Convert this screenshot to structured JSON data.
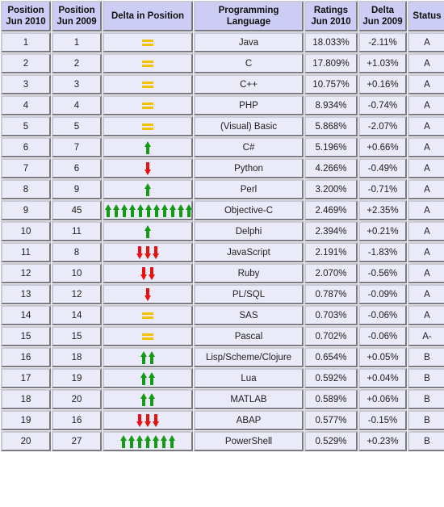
{
  "table": {
    "columns": [
      {
        "key": "position_new",
        "label": "Position\nJun 2010",
        "line1": "Position",
        "line2": "Jun 2010"
      },
      {
        "key": "position_old",
        "label": "Position\nJun 2009",
        "line1": "Position",
        "line2": "Jun 2009"
      },
      {
        "key": "delta_position",
        "label": "Delta in Position",
        "line1": "Delta in Position",
        "line2": ""
      },
      {
        "key": "language",
        "label": "Programming Language",
        "line1": "Programming Language",
        "line2": ""
      },
      {
        "key": "ratings",
        "label": "Ratings\nJun 2010",
        "line1": "Ratings",
        "line2": "Jun 2010"
      },
      {
        "key": "delta_ratings",
        "label": "Delta\nJun 2009",
        "line1": "Delta",
        "line2": "Jun 2009"
      },
      {
        "key": "status",
        "label": "Status",
        "line1": "Status",
        "line2": ""
      }
    ],
    "rows": [
      {
        "position_new": "1",
        "position_old": "1",
        "delta_icon": "equals-icon",
        "delta_count": 1,
        "language": "Java",
        "ratings": "18.033%",
        "delta_ratings": "-2.11%",
        "status": "A"
      },
      {
        "position_new": "2",
        "position_old": "2",
        "delta_icon": "equals-icon",
        "delta_count": 1,
        "language": "C",
        "ratings": "17.809%",
        "delta_ratings": "+1.03%",
        "status": "A"
      },
      {
        "position_new": "3",
        "position_old": "3",
        "delta_icon": "equals-icon",
        "delta_count": 1,
        "language": "C++",
        "ratings": "10.757%",
        "delta_ratings": "+0.16%",
        "status": "A"
      },
      {
        "position_new": "4",
        "position_old": "4",
        "delta_icon": "equals-icon",
        "delta_count": 1,
        "language": "PHP",
        "ratings": "8.934%",
        "delta_ratings": "-0.74%",
        "status": "A"
      },
      {
        "position_new": "5",
        "position_old": "5",
        "delta_icon": "equals-icon",
        "delta_count": 1,
        "language": "(Visual) Basic",
        "ratings": "5.868%",
        "delta_ratings": "-2.07%",
        "status": "A"
      },
      {
        "position_new": "6",
        "position_old": "7",
        "delta_icon": "arrow-up-icon",
        "delta_count": 1,
        "language": "C#",
        "ratings": "5.196%",
        "delta_ratings": "+0.66%",
        "status": "A"
      },
      {
        "position_new": "7",
        "position_old": "6",
        "delta_icon": "arrow-down-icon",
        "delta_count": 1,
        "language": "Python",
        "ratings": "4.266%",
        "delta_ratings": "-0.49%",
        "status": "A"
      },
      {
        "position_new": "8",
        "position_old": "9",
        "delta_icon": "arrow-up-icon",
        "delta_count": 1,
        "language": "Perl",
        "ratings": "3.200%",
        "delta_ratings": "-0.71%",
        "status": "A"
      },
      {
        "position_new": "9",
        "position_old": "45",
        "delta_icon": "arrow-up-icon",
        "delta_count": 11,
        "language": "Objective-C",
        "ratings": "2.469%",
        "delta_ratings": "+2.35%",
        "status": "A"
      },
      {
        "position_new": "10",
        "position_old": "11",
        "delta_icon": "arrow-up-icon",
        "delta_count": 1,
        "language": "Delphi",
        "ratings": "2.394%",
        "delta_ratings": "+0.21%",
        "status": "A"
      },
      {
        "position_new": "11",
        "position_old": "8",
        "delta_icon": "arrow-down-icon",
        "delta_count": 3,
        "language": "JavaScript",
        "ratings": "2.191%",
        "delta_ratings": "-1.83%",
        "status": "A"
      },
      {
        "position_new": "12",
        "position_old": "10",
        "delta_icon": "arrow-down-icon",
        "delta_count": 2,
        "language": "Ruby",
        "ratings": "2.070%",
        "delta_ratings": "-0.56%",
        "status": "A"
      },
      {
        "position_new": "13",
        "position_old": "12",
        "delta_icon": "arrow-down-icon",
        "delta_count": 1,
        "language": "PL/SQL",
        "ratings": "0.787%",
        "delta_ratings": "-0.09%",
        "status": "A"
      },
      {
        "position_new": "14",
        "position_old": "14",
        "delta_icon": "equals-icon",
        "delta_count": 1,
        "language": "SAS",
        "ratings": "0.703%",
        "delta_ratings": "-0.06%",
        "status": "A"
      },
      {
        "position_new": "15",
        "position_old": "15",
        "delta_icon": "equals-icon",
        "delta_count": 1,
        "language": "Pascal",
        "ratings": "0.702%",
        "delta_ratings": "-0.06%",
        "status": "A-"
      },
      {
        "position_new": "16",
        "position_old": "18",
        "delta_icon": "arrow-up-icon",
        "delta_count": 2,
        "language": "Lisp/Scheme/Clojure",
        "ratings": "0.654%",
        "delta_ratings": "+0.05%",
        "status": "B"
      },
      {
        "position_new": "17",
        "position_old": "19",
        "delta_icon": "arrow-up-icon",
        "delta_count": 2,
        "language": "Lua",
        "ratings": "0.592%",
        "delta_ratings": "+0.04%",
        "status": "B"
      },
      {
        "position_new": "18",
        "position_old": "20",
        "delta_icon": "arrow-up-icon",
        "delta_count": 2,
        "language": "MATLAB",
        "ratings": "0.589%",
        "delta_ratings": "+0.06%",
        "status": "B"
      },
      {
        "position_new": "19",
        "position_old": "16",
        "delta_icon": "arrow-down-icon",
        "delta_count": 3,
        "language": "ABAP",
        "ratings": "0.577%",
        "delta_ratings": "-0.15%",
        "status": "B"
      },
      {
        "position_new": "20",
        "position_old": "27",
        "delta_icon": "arrow-up-icon",
        "delta_count": 7,
        "language": "PowerShell",
        "ratings": "0.529%",
        "delta_ratings": "+0.23%",
        "status": "B"
      }
    ]
  },
  "colors": {
    "header_background": "#ccccf5",
    "cell_background": "#eaeaf8",
    "language_text": "#3b3bbf",
    "arrow_up": "#149b14",
    "arrow_down": "#e81010",
    "equals": "#f2c200",
    "border": "#c9c9d6"
  }
}
